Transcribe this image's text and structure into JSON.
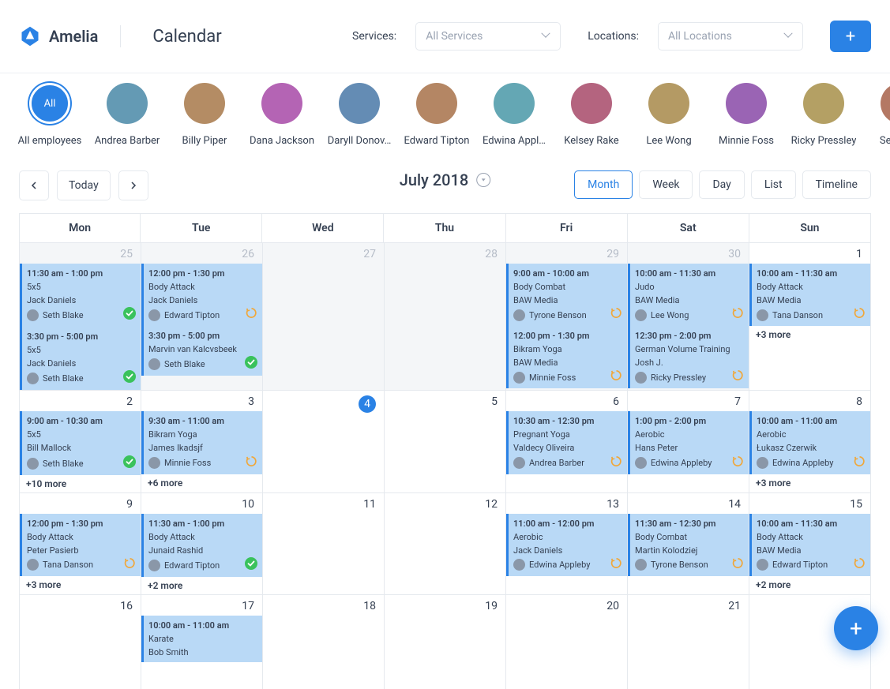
{
  "brand": "Amelia",
  "page_title": "Calendar",
  "filters": {
    "services_label": "Services:",
    "services_placeholder": "All Services",
    "locations_label": "Locations:",
    "locations_placeholder": "All Locations"
  },
  "employees": [
    {
      "name": "All employees",
      "selected": true,
      "label": "All"
    },
    {
      "name": "Andrea Barber"
    },
    {
      "name": "Billy Piper"
    },
    {
      "name": "Dana Jackson"
    },
    {
      "name": "Daryll Donov…"
    },
    {
      "name": "Edward Tipton"
    },
    {
      "name": "Edwina Appl…"
    },
    {
      "name": "Kelsey Rake"
    },
    {
      "name": "Lee Wong"
    },
    {
      "name": "Minnie Foss"
    },
    {
      "name": "Ricky Pressley"
    },
    {
      "name": "Seth Blak"
    }
  ],
  "toolbar": {
    "today": "Today",
    "current": "July 2018",
    "views": [
      "Month",
      "Week",
      "Day",
      "List",
      "Timeline"
    ],
    "active_view": "Month"
  },
  "weekdays": [
    "Mon",
    "Tue",
    "Wed",
    "Thu",
    "Fri",
    "Sat",
    "Sun"
  ],
  "cells": [
    {
      "date": "25",
      "outside": true,
      "events": [
        {
          "time": "11:30 am - 1:00 pm",
          "service": "5x5",
          "customer": "Jack Daniels",
          "employee": "Seth Blake",
          "status": "approved"
        },
        {
          "time": "3:30 pm - 5:00 pm",
          "service": "5x5",
          "customer": "Jack Daniels",
          "employee": "Seth Blake",
          "status": "approved"
        }
      ]
    },
    {
      "date": "26",
      "outside": true,
      "events": [
        {
          "time": "12:00 pm - 1:30 pm",
          "service": "Body Attack",
          "customer": "Jack Daniels",
          "employee": "Edward Tipton",
          "status": "recurring"
        },
        {
          "time": "3:30 pm - 5:00 pm",
          "service": "Marvin van Kalcvsbeek",
          "customer": "",
          "employee": "Seth Blake",
          "status": "approved"
        }
      ]
    },
    {
      "date": "27",
      "outside": true,
      "events": []
    },
    {
      "date": "28",
      "outside": true,
      "events": []
    },
    {
      "date": "29",
      "outside": true,
      "events": [
        {
          "time": "9:00 am - 10:00 am",
          "service": "Body Combat",
          "customer": "BAW Media",
          "employee": "Tyrone Benson",
          "status": "recurring"
        },
        {
          "time": "12:00 pm - 1:30 pm",
          "service": "Bikram Yoga",
          "customer": "BAW Media",
          "employee": "Minnie Foss",
          "status": "recurring"
        }
      ]
    },
    {
      "date": "30",
      "outside": true,
      "events": [
        {
          "time": "10:00 am - 11:30 am",
          "service": "Judo",
          "customer": "BAW Media",
          "employee": "Lee Wong",
          "status": "recurring"
        },
        {
          "time": "12:30 pm - 2:00 pm",
          "service": "German Volume Training",
          "customer": "Josh J.",
          "employee": "Ricky Pressley",
          "status": "recurring"
        }
      ]
    },
    {
      "date": "1",
      "events": [
        {
          "time": "10:00 am - 11:30 am",
          "service": "Body Attack",
          "customer": "BAW Media",
          "employee": "Tana Danson",
          "status": "recurring"
        }
      ],
      "more": "+3 more"
    },
    {
      "date": "2",
      "events": [
        {
          "time": "9:00 am - 10:30 am",
          "service": "5x5",
          "customer": "Bill Mallock",
          "employee": "Seth Blake",
          "status": "approved"
        }
      ],
      "more": "+10 more"
    },
    {
      "date": "3",
      "events": [
        {
          "time": "9:30 am - 11:00 am",
          "service": "Bikram Yoga",
          "customer": "James Ikadsjf",
          "employee": "Minnie Foss",
          "status": "recurring"
        }
      ],
      "more": "+6 more"
    },
    {
      "date": "4",
      "today": true,
      "events": []
    },
    {
      "date": "5",
      "events": []
    },
    {
      "date": "6",
      "events": [
        {
          "time": "10:30 am - 12:30 pm",
          "service": "Pregnant Yoga",
          "customer": "Valdecy Oliveira",
          "employee": "Andrea Barber",
          "status": "recurring"
        }
      ]
    },
    {
      "date": "7",
      "events": [
        {
          "time": "1:00 pm - 2:00 pm",
          "service": "Aerobic",
          "customer": "Hans Peter",
          "employee": "Edwina Appleby",
          "status": "recurring"
        }
      ]
    },
    {
      "date": "8",
      "events": [
        {
          "time": "10:00 am - 11:00 am",
          "service": "Aerobic",
          "customer": "Łukasz Czerwik",
          "employee": "Edwina Appleby",
          "status": "recurring"
        }
      ],
      "more": "+3 more"
    },
    {
      "date": "9",
      "events": [
        {
          "time": "12:00 pm - 1:30 pm",
          "service": "Body Attack",
          "customer": "Peter Pasierb",
          "employee": "Tana Danson",
          "status": "recurring"
        }
      ],
      "more": "+3 more"
    },
    {
      "date": "10",
      "events": [
        {
          "time": "11:30 am - 1:00 pm",
          "service": "Body Attack",
          "customer": "Junaid Rashid",
          "employee": "Edward Tipton",
          "status": "approved"
        }
      ],
      "more": "+2 more"
    },
    {
      "date": "11",
      "events": []
    },
    {
      "date": "12",
      "events": []
    },
    {
      "date": "13",
      "events": [
        {
          "time": "11:00 am - 12:00 pm",
          "service": "Aerobic",
          "customer": "Jack Daniels",
          "employee": "Edwina Appleby",
          "status": "recurring"
        }
      ]
    },
    {
      "date": "14",
      "events": [
        {
          "time": "11:30 am - 12:30 pm",
          "service": "Body Combat",
          "customer": "Martin Kolodziej",
          "employee": "Tyrone Benson",
          "status": "recurring"
        }
      ]
    },
    {
      "date": "15",
      "events": [
        {
          "time": "10:00 am - 11:30 am",
          "service": "Body Attack",
          "customer": "BAW Media",
          "employee": "Edward Tipton",
          "status": "recurring"
        }
      ],
      "more": "+2 more"
    },
    {
      "date": "16",
      "events": []
    },
    {
      "date": "17",
      "events": [
        {
          "time": "10:00 am - 11:00 am",
          "service": "Karate",
          "customer": "Bob Smith",
          "employee": "",
          "status": ""
        }
      ]
    },
    {
      "date": "18",
      "events": []
    },
    {
      "date": "19",
      "events": []
    },
    {
      "date": "20",
      "events": []
    },
    {
      "date": "21",
      "events": []
    },
    {
      "date": "",
      "events": []
    }
  ]
}
